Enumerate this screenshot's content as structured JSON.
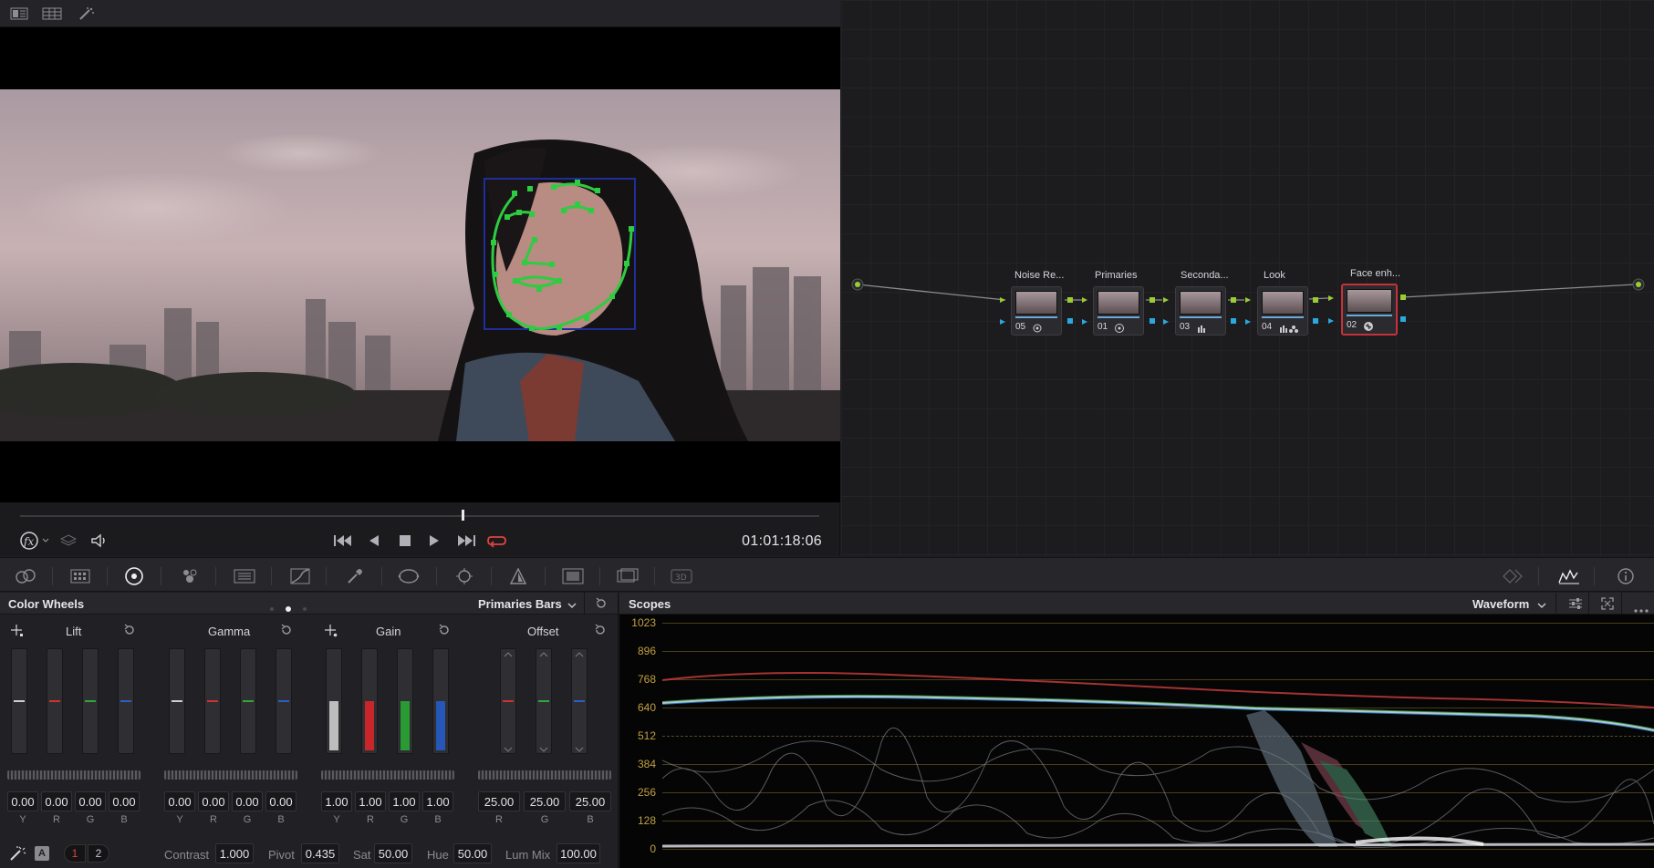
{
  "viewer": {
    "timecode": "01:01:18:06"
  },
  "nodes": [
    {
      "label": "Noise Re...",
      "num": "05"
    },
    {
      "label": "Primaries",
      "num": "01"
    },
    {
      "label": "Seconda...",
      "num": "03"
    },
    {
      "label": "Look",
      "num": "04"
    },
    {
      "label": "Face enh...",
      "num": "02"
    }
  ],
  "color_wheels": {
    "title": "Color Wheels",
    "mode": "Primaries Bars",
    "groups": [
      {
        "name": "Lift",
        "values": [
          "0.00",
          "0.00",
          "0.00",
          "0.00"
        ],
        "channels": [
          "Y",
          "R",
          "G",
          "B"
        ]
      },
      {
        "name": "Gamma",
        "values": [
          "0.00",
          "0.00",
          "0.00",
          "0.00"
        ],
        "channels": [
          "Y",
          "R",
          "G",
          "B"
        ]
      },
      {
        "name": "Gain",
        "values": [
          "1.00",
          "1.00",
          "1.00",
          "1.00"
        ],
        "channels": [
          "Y",
          "R",
          "G",
          "B"
        ]
      },
      {
        "name": "Offset",
        "values": [
          "25.00",
          "25.00",
          "25.00"
        ],
        "channels": [
          "R",
          "G",
          "B"
        ]
      }
    ],
    "bottom": {
      "page_1": "1",
      "page_2": "2",
      "auto_label": "A",
      "contrast_label": "Contrast",
      "contrast": "1.000",
      "pivot_label": "Pivot",
      "pivot": "0.435",
      "sat_label": "Sat",
      "sat": "50.00",
      "hue_label": "Hue",
      "hue": "50.00",
      "lummix_label": "Lum Mix",
      "lummix": "100.00"
    }
  },
  "scopes": {
    "title": "Scopes",
    "mode": "Waveform",
    "scale": [
      "1023",
      "896",
      "768",
      "640",
      "512",
      "384",
      "256",
      "128",
      "0"
    ]
  },
  "colors": {
    "accent_red": "#c6313a",
    "node_green": "#9acd32",
    "node_blue": "#2aa8e0",
    "scale_gold": "#c0a040"
  }
}
